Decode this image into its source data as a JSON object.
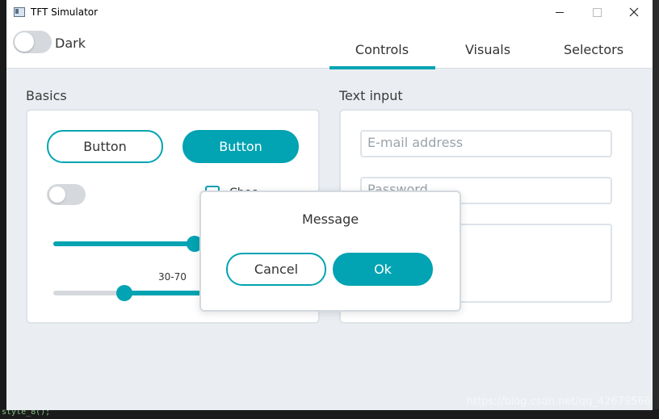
{
  "window": {
    "title": "TFT Simulator"
  },
  "header": {
    "dark_label": "Dark",
    "tabs": [
      {
        "label": "Controls",
        "active": true
      },
      {
        "label": "Visuals",
        "active": false
      },
      {
        "label": "Selectors",
        "active": false
      }
    ],
    "accent_color": "#02a3b2"
  },
  "basics": {
    "title": "Basics",
    "button_outline_label": "Button",
    "button_filled_label": "Button",
    "switch_on": false,
    "checkbox_label": "Chec",
    "slider_value_fraction": 0.6,
    "range_label": "30-70",
    "range_start_fraction": 0.3,
    "range_end_fraction": 0.7
  },
  "text_input": {
    "title": "Text input",
    "email_placeholder": "E-mail address",
    "password_placeholder": "Password"
  },
  "message_box": {
    "title": "Message",
    "cancel_label": "Cancel",
    "ok_label": "Ok"
  },
  "background": {
    "code_snippet": "style_8();",
    "watermark": "https://blog.csdn.net/qq_42679566"
  }
}
